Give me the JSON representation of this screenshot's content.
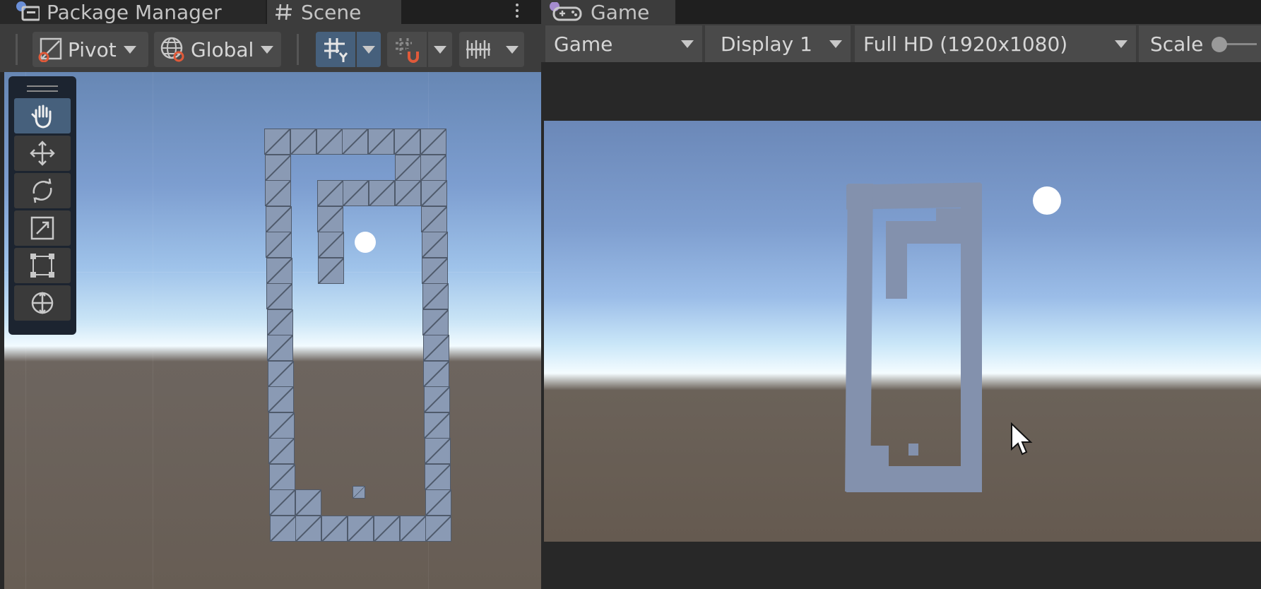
{
  "tabs": {
    "package_manager": "Package Manager",
    "scene": "Scene",
    "game": "Game"
  },
  "scene_toolbar": {
    "pivot_label": "Pivot",
    "global_label": "Global"
  },
  "scene_tools": [
    {
      "name": "hand-tool",
      "icon": "hand-icon",
      "active": true
    },
    {
      "name": "move-tool",
      "icon": "move-arrows-icon",
      "active": false
    },
    {
      "name": "rotate-tool",
      "icon": "rotate-icon",
      "active": false
    },
    {
      "name": "scale-tool",
      "icon": "scale-icon",
      "active": false
    },
    {
      "name": "rect-tool",
      "icon": "rect-transform-icon",
      "active": false
    },
    {
      "name": "transform-tool",
      "icon": "transform-icon",
      "active": false
    }
  ],
  "game_toolbar": {
    "view_mode": "Game",
    "display": "Display 1",
    "resolution": "Full HD (1920x1080)",
    "scale_label": "Scale"
  },
  "colors": {
    "active_tool": "#46607c",
    "block": "#8a9ab4",
    "panel": "#3c3c3c"
  }
}
